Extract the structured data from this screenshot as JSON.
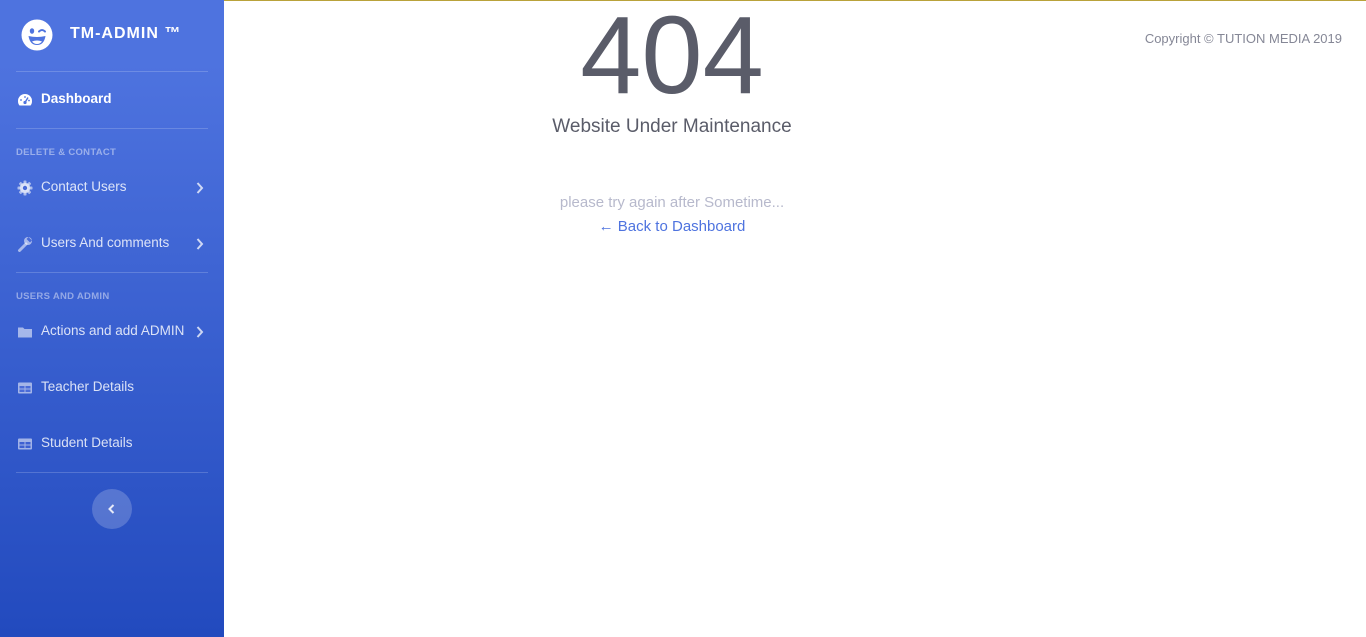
{
  "brand": {
    "name": "TM-ADMIN ™",
    "icon": "laugh-wink-icon"
  },
  "sidebar": {
    "dashboard": {
      "label": "Dashboard",
      "icon": "tachometer-icon"
    },
    "heading_1": "DELETE & CONTACT",
    "items_1": [
      {
        "label": "Contact Users",
        "icon": "cog-icon",
        "has_chevron": true
      },
      {
        "label": "Users And comments",
        "icon": "wrench-icon",
        "has_chevron": true
      }
    ],
    "heading_2": "USERS AND ADMIN",
    "items_2": [
      {
        "label": "Actions and add ADMIN",
        "icon": "folder-icon",
        "has_chevron": true
      },
      {
        "label": "Teacher Details",
        "icon": "table-icon",
        "has_chevron": false
      },
      {
        "label": "Student Details",
        "icon": "table-icon",
        "has_chevron": false
      }
    ],
    "toggle_icon": "angle-left-icon"
  },
  "main": {
    "copyright": "Copyright © TUTION MEDIA 2019",
    "error_code": "404",
    "subtitle": "Website Under Maintenance",
    "message": "please try again after Sometime...",
    "back_link": "← Back to Dashboard"
  },
  "colors": {
    "sidebar_top": "#4e73df",
    "sidebar_bottom": "#224abe",
    "text_dark": "#5a5c69",
    "text_muted": "#b7b9cc",
    "link": "#4e73df",
    "top_border": "#b9a23a"
  }
}
